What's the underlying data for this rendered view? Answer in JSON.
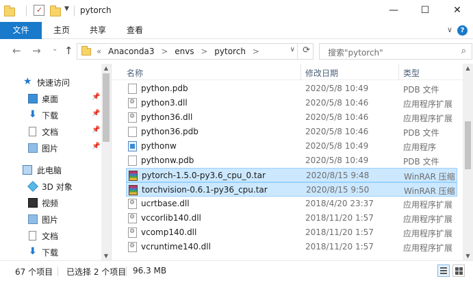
{
  "window": {
    "title": "pytorch",
    "min_symbol": "—",
    "max_symbol": "☐",
    "close_symbol": "✕"
  },
  "ribbon": {
    "tabs": [
      "文件",
      "主页",
      "共享",
      "查看"
    ],
    "help_symbol": "?",
    "expand_symbol": "∨"
  },
  "nav": {
    "back": "←",
    "forward": "→",
    "recent": "⌄",
    "up": "↑"
  },
  "address": {
    "prefix": "«",
    "crumbs": [
      "Anaconda3",
      "envs",
      "pytorch"
    ],
    "separator": ">",
    "dropdown": "∨",
    "refresh": "⟳"
  },
  "search": {
    "placeholder": "搜索\"pytorch\"",
    "icon": "⌕"
  },
  "sidebar": {
    "items": [
      {
        "label": "快速访问",
        "icon": "star-icon",
        "pinned": false
      },
      {
        "label": "桌面",
        "icon": "desktop-icon",
        "pinned": true
      },
      {
        "label": "下载",
        "icon": "download-icon",
        "pinned": true
      },
      {
        "label": "文档",
        "icon": "document-icon",
        "pinned": true
      },
      {
        "label": "图片",
        "icon": "pictures-icon",
        "pinned": true
      },
      {
        "label": "此电脑",
        "icon": "computer-icon",
        "pinned": false
      },
      {
        "label": "3D 对象",
        "icon": "3d-objects-icon",
        "pinned": false
      },
      {
        "label": "视频",
        "icon": "video-icon",
        "pinned": false
      },
      {
        "label": "图片",
        "icon": "pictures-icon",
        "pinned": false
      },
      {
        "label": "文档",
        "icon": "document-icon",
        "pinned": false
      },
      {
        "label": "下载",
        "icon": "download-icon",
        "pinned": false
      }
    ],
    "pin_symbol": "📌"
  },
  "columns": {
    "name": "名称",
    "date": "修改日期",
    "type": "类型",
    "sort_symbol": "^"
  },
  "files": [
    {
      "name": "python.pdb",
      "date": "2020/5/8 10:49",
      "type": "PDB 文件",
      "icon": "file",
      "selected": false
    },
    {
      "name": "python3.dll",
      "date": "2020/5/8 10:46",
      "type": "应用程序扩展",
      "icon": "dll",
      "selected": false
    },
    {
      "name": "python36.dll",
      "date": "2020/5/8 10:46",
      "type": "应用程序扩展",
      "icon": "dll",
      "selected": false
    },
    {
      "name": "python36.pdb",
      "date": "2020/5/8 10:46",
      "type": "PDB 文件",
      "icon": "file",
      "selected": false
    },
    {
      "name": "pythonw",
      "date": "2020/5/8 10:49",
      "type": "应用程序",
      "icon": "exe",
      "selected": false
    },
    {
      "name": "pythonw.pdb",
      "date": "2020/5/8 10:49",
      "type": "PDB 文件",
      "icon": "file",
      "selected": false
    },
    {
      "name": "pytorch-1.5.0-py3.6_cpu_0.tar",
      "date": "2020/8/15 9:48",
      "type": "WinRAR 压缩",
      "icon": "rar",
      "selected": true
    },
    {
      "name": "torchvision-0.6.1-py36_cpu.tar",
      "date": "2020/8/15 9:50",
      "type": "WinRAR 压缩",
      "icon": "rar",
      "selected": true
    },
    {
      "name": "ucrtbase.dll",
      "date": "2018/4/20 23:37",
      "type": "应用程序扩展",
      "icon": "dll",
      "selected": false
    },
    {
      "name": "vccorlib140.dll",
      "date": "2018/11/20 1:57",
      "type": "应用程序扩展",
      "icon": "dll",
      "selected": false
    },
    {
      "name": "vcomp140.dll",
      "date": "2018/11/20 1:57",
      "type": "应用程序扩展",
      "icon": "dll",
      "selected": false
    },
    {
      "name": "vcruntime140.dll",
      "date": "2018/11/20 1:57",
      "type": "应用程序扩展",
      "icon": "dll",
      "selected": false
    }
  ],
  "status": {
    "count": "67 个项目",
    "selection": "已选择 2 个项目",
    "size": "96.3 MB"
  },
  "scroll": {
    "up": "▲",
    "down": "▼"
  }
}
